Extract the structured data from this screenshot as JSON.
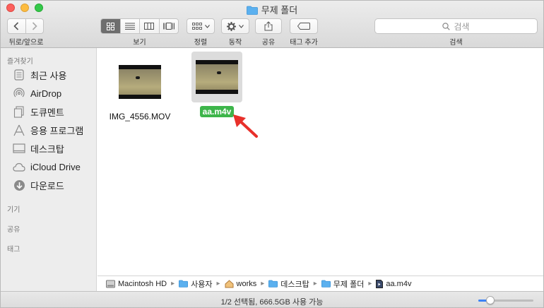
{
  "window": {
    "title": "무제 폴더"
  },
  "toolbar": {
    "nav_label": "뒤로/앞으로",
    "view_label": "보기",
    "arrange_label": "정렬",
    "action_label": "동작",
    "share_label": "공유",
    "tags_label": "태그 추가",
    "search_label": "검색",
    "search_placeholder": "검색"
  },
  "sidebar": {
    "favorites_header": "즐겨찾기",
    "items": [
      {
        "label": "최근 사용",
        "icon": "recents-icon"
      },
      {
        "label": "AirDrop",
        "icon": "airdrop-icon"
      },
      {
        "label": "도큐멘트",
        "icon": "documents-icon"
      },
      {
        "label": "응용 프로그램",
        "icon": "applications-icon"
      },
      {
        "label": "데스크탑",
        "icon": "desktop-icon"
      },
      {
        "label": "iCloud Drive",
        "icon": "icloud-icon"
      },
      {
        "label": "다운로드",
        "icon": "downloads-icon"
      }
    ],
    "devices_header": "기기",
    "shared_header": "공유",
    "tags_header": "태그"
  },
  "files": [
    {
      "name": "IMG_4556.MOV",
      "selected": false
    },
    {
      "name": "aa.m4v",
      "selected": true
    }
  ],
  "pathbar": {
    "crumbs": [
      "Macintosh HD",
      "사용자",
      "works",
      "데스크탑",
      "무제 폴더",
      "aa.m4v"
    ]
  },
  "statusbar": {
    "text": "1/2 선택됨, 666.5GB 사용 가능",
    "zoom_fraction": 0.22
  },
  "colors": {
    "selection_green": "#3db54a",
    "annotation_red": "#e8302a",
    "accent_blue": "#3b82f6"
  }
}
